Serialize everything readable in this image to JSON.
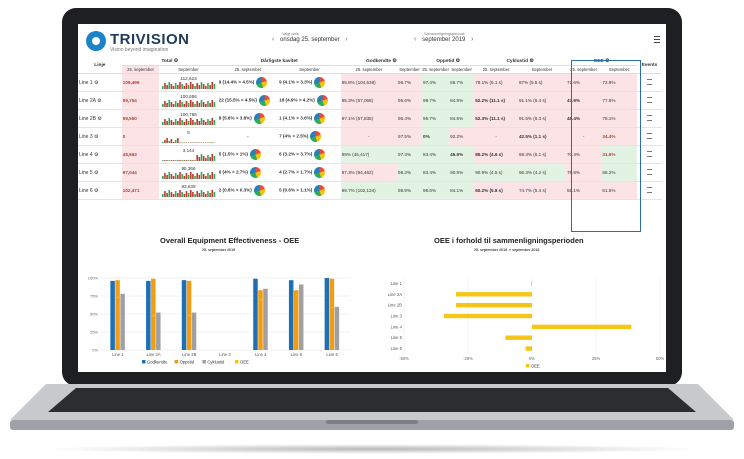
{
  "brand": {
    "name": "TRIVISION",
    "tagline": "Vision beyond imagination"
  },
  "date_selector": {
    "label": "Valgt dato",
    "value": "onsdag 25. september"
  },
  "comparison_selector": {
    "label": "Sammenligningsperiode",
    "value": "september 2019"
  },
  "table": {
    "headers": {
      "line": "Linje",
      "total": "Total ⚙",
      "bad_quality": "Dårligste kavitet",
      "approved": "Godkendte ⚙",
      "uptime": "Oppetid ⚙",
      "cycle_time": "Cyklustid ⚙",
      "oee": "OEE ⚙",
      "events": "Events"
    },
    "sub_day": "25. september",
    "sub_month": "September",
    "rows": [
      {
        "line": "Line 1 ⚙",
        "total_day": "109,499",
        "total_month": "112,623",
        "bad_day": "9 (14.4% > 4.5%)",
        "bad_month": "9 (4.1% > 3.3%)",
        "app_day": "95.5% (104,538)",
        "app_month": "96.7%",
        "up_day": "97.4%",
        "up_month": "86.7%",
        "cyc_day": "78.1% (6.1 s)",
        "cyc_month": "87% (5.5 s)",
        "oee_day": "72.6%",
        "oee_month": "72.9%"
      },
      {
        "line": "Line 2A ⚙",
        "total_day": "59,754",
        "total_month": "100,656",
        "bad_day": "22 (15.5% > 4.5%)",
        "bad_month": "18 (4.9% > 4.2%)",
        "app_day": "95.3% (57,058)",
        "app_month": "95.6%",
        "up_day": "98.7%",
        "up_month": "84.9%",
        "cyc_day": "52.2% (11.1 s)",
        "cyc_month": "91.1% (6.4 s)",
        "oee_day": "47.9%",
        "oee_month": "77.6%"
      },
      {
        "line": "Line 2B ⚙",
        "total_day": "59,550",
        "total_month": "100,766",
        "bad_day": "8 (5.6% > 3.8%)",
        "bad_month": "1 (4.1% > 3.6%)",
        "app_day": "97.1% (57,835)",
        "app_month": "96.4%",
        "up_day": "95.7%",
        "up_month": "84.6%",
        "cyc_day": "52.3% (11.1 s)",
        "cyc_month": "91.5% (6.3 s)",
        "oee_day": "48.4%",
        "oee_month": "78.1%"
      },
      {
        "line": "Line 3 ⚙",
        "total_day": "0",
        "total_month": "5",
        "bad_day": "-",
        "bad_month": "7 (4% > 2.5%)",
        "app_day": "-",
        "app_month": "97.5%",
        "up_day": "0%",
        "up_month": "92.2%",
        "cyc_day": "-",
        "cyc_month": "42.5% (1.1 s)",
        "oee_day": "-",
        "oee_month": "34.4%"
      },
      {
        "line": "Line 4 ⚙",
        "total_day": "45,663",
        "total_month": "3,144",
        "bad_day": "5 (1.5% > 1%)",
        "bad_month": "6 (3.2% > 3.7%)",
        "app_day": "99% (45,417)",
        "app_month": "97.3%",
        "up_day": "83.4%",
        "up_month": "46.9%",
        "cyc_day": "85.2% (4.6 s)",
        "cyc_month": "69.3% (6.1 s)",
        "oee_day": "70.4%",
        "oee_month": "31.6%"
      },
      {
        "line": "Line 5 ⚙",
        "total_day": "97,044",
        "total_month": "95,366",
        "bad_day": "6 (4% > 2.7%)",
        "bad_month": "4 (2.7% > 1.7%)",
        "app_day": "97.3% (94,462)",
        "app_month": "98.3%",
        "up_day": "83.4%",
        "up_month": "90.9%",
        "cyc_day": "90.9% (4.5 s)",
        "cyc_month": "96.3% (4.2 s)",
        "oee_day": "75.8%",
        "oee_month": "86.2%"
      },
      {
        "line": "Line 6 ⚙",
        "total_day": "102,471",
        "total_month": "93,639",
        "bad_day": "2 (0.6% > 0.3%)",
        "bad_month": "5 (0.6% > 1.1%)",
        "app_day": "99.7% (102,134)",
        "app_month": "98.9%",
        "up_day": "98.6%",
        "up_month": "84.1%",
        "cyc_day": "60.2% (5.8 s)",
        "cyc_month": "74.7% (5.4 s)",
        "oee_day": "59.1%",
        "oee_month": "61.6%"
      }
    ]
  },
  "chart_data": [
    {
      "type": "bar",
      "title": "Overall Equipment Effectiveness - OEE",
      "subtitle": "25. september 2019",
      "categories": [
        "Line 1",
        "Line 2A",
        "Line 2B",
        "Line 3",
        "Line 4",
        "Line 5",
        "Line 6"
      ],
      "series": [
        {
          "name": "Godkendte",
          "color": "#1f6fb5",
          "values": [
            96,
            96,
            97,
            0,
            99,
            97,
            100
          ]
        },
        {
          "name": "Oppetid",
          "color": "#f39c12",
          "values": [
            97,
            99,
            96,
            0,
            83,
            83,
            99
          ]
        },
        {
          "name": "Cyklustid",
          "color": "#a0a0a0",
          "values": [
            78,
            52,
            52,
            0,
            85,
            91,
            60
          ]
        },
        {
          "name": "OEE",
          "color": "#f5c518",
          "values": [
            73,
            48,
            48,
            0,
            70,
            76,
            59
          ]
        }
      ],
      "yticks": [
        "0%",
        "25%",
        "50%",
        "75%",
        "100%"
      ],
      "ylim": [
        0,
        100
      ],
      "legend": "bottom"
    },
    {
      "type": "bar",
      "orientation": "horizontal",
      "title": "OEE i forhold til sammenligningsperioden",
      "subtitle": "25. september 2019 ↗ september 2019",
      "categories": [
        "Line 1",
        "Line 2A",
        "Line 2B",
        "Line 3",
        "Line 4",
        "Line 5",
        "Line 6"
      ],
      "series": [
        {
          "name": "OEE",
          "color": "#f5c518",
          "values": [
            -0.3,
            -29.7,
            -29.7,
            -34.4,
            38.8,
            -10.4,
            -2.5
          ]
        }
      ],
      "xticks": [
        "-50%",
        "-25%",
        "0%",
        "25%",
        "50%"
      ],
      "xlim": [
        -50,
        50
      ],
      "legend": "bottom"
    }
  ]
}
